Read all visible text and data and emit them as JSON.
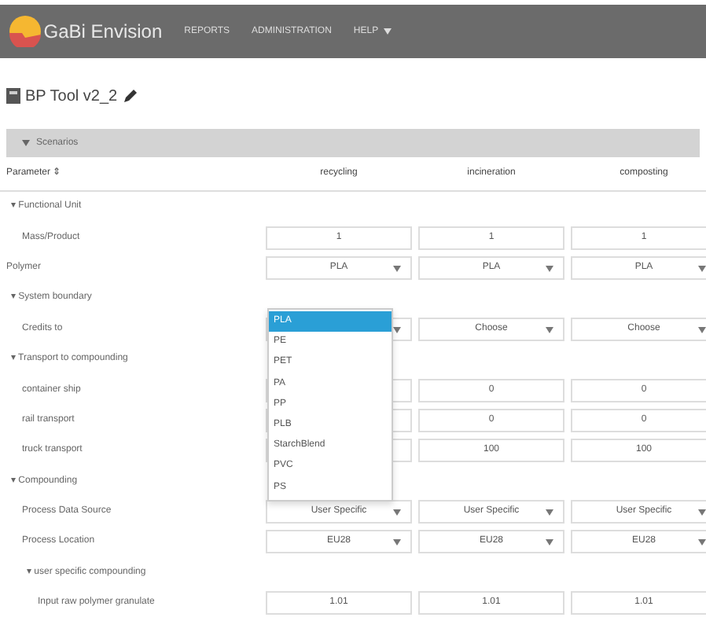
{
  "navbar": {
    "brand": "GaBi Envision",
    "links": [
      {
        "label": "REPORTS",
        "dropdown": false
      },
      {
        "label": "ADMINISTRATION",
        "dropdown": false
      },
      {
        "label": "HELP",
        "dropdown": true
      }
    ]
  },
  "page_title": "BP Tool v2_2",
  "section": {
    "title": "Scenarios"
  },
  "table": {
    "columns": [
      "Parameter ⇕",
      "recycling",
      "incineration",
      "composting"
    ],
    "rows": [
      {
        "kind": "group",
        "toggle": "▾",
        "label": "Functional Unit",
        "children": [
          {
            "kind": "input",
            "label": "Mass/Product",
            "cells": [
              "1",
              "1",
              "1"
            ]
          }
        ]
      },
      {
        "kind": "select",
        "label": "Polymer",
        "cells": [
          "PLA",
          "PLA",
          "PLA"
        ]
      },
      {
        "kind": "group",
        "toggle": "▾",
        "label": "System boundary",
        "children": [
          {
            "kind": "select",
            "label": "Credits to",
            "cells": [
              null,
              "Choose",
              "Choose"
            ]
          }
        ]
      },
      {
        "kind": "group",
        "toggle": "▾",
        "label": "Transport to compounding",
        "children": [
          {
            "kind": "input",
            "label": "container ship",
            "cells": [
              null,
              "0",
              "0"
            ]
          },
          {
            "kind": "input",
            "label": "rail transport",
            "cells": [
              null,
              "0",
              "0"
            ]
          },
          {
            "kind": "input",
            "label": "truck transport",
            "cells": [
              null,
              "100",
              "100"
            ]
          }
        ]
      },
      {
        "kind": "group",
        "toggle": "▾",
        "label": "Compounding",
        "children": [
          {
            "kind": "select",
            "label": "Process Data Source",
            "cells": [
              "User Specific",
              "User Specific",
              "User Specific"
            ]
          },
          {
            "kind": "select",
            "label": "Process Location",
            "cells": [
              "EU28",
              "EU28",
              "EU28"
            ]
          },
          {
            "kind": "group",
            "toggle": "▾",
            "label": "user specific compounding",
            "children": [
              {
                "kind": "input",
                "label": "Input raw polymer granulate",
                "cells": [
                  "1.01",
                  "1.01",
                  "1.01"
                ]
              }
            ]
          }
        ]
      }
    ]
  },
  "dropdown": {
    "items": [
      {
        "label": "PLA",
        "selected": true
      },
      {
        "label": "PE",
        "selected": false
      },
      {
        "label": "PET",
        "selected": false
      },
      {
        "label": "PA",
        "selected": false
      },
      {
        "label": "PP",
        "selected": false
      },
      {
        "label": "PLB",
        "selected": false
      },
      {
        "label": "StarchBlend",
        "selected": false
      },
      {
        "label": "PVC",
        "selected": false
      },
      {
        "label": "PS",
        "selected": false
      }
    ]
  }
}
